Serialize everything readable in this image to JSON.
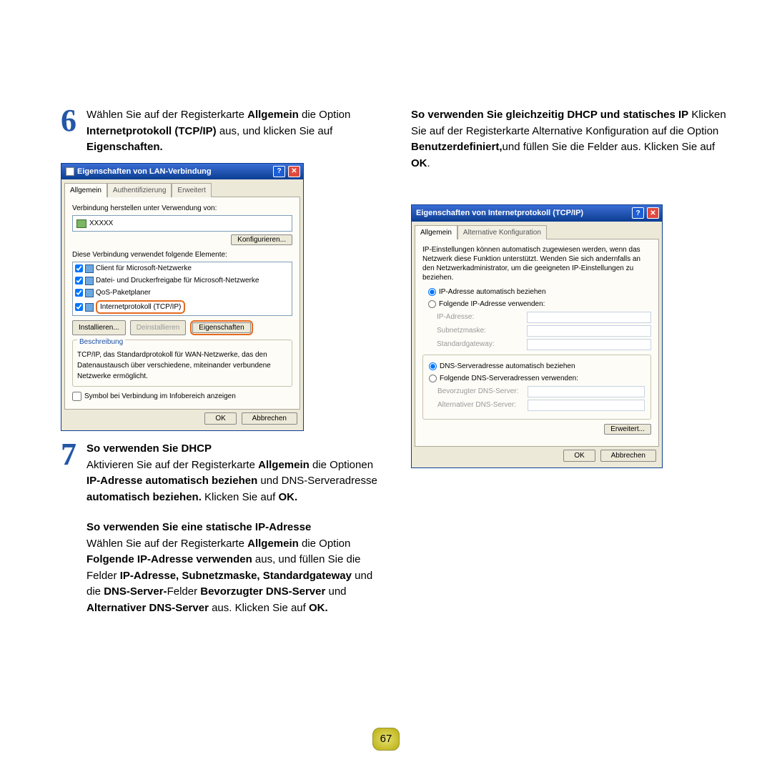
{
  "page_number": "67",
  "left": {
    "step6": {
      "num": "6",
      "p1a": "Wählen Sie auf der Registerkarte ",
      "b1": "Allgemein",
      "p1b": " die Option ",
      "b2": "Internetprotokoll (TCP/IP)",
      "p1c": " aus, und klicken Sie auf ",
      "b3": "Eigenschaften.",
      "p1d": ""
    },
    "dlg1": {
      "title": "Eigenschaften von LAN-Verbindung",
      "tabs": [
        "Allgemein",
        "Authentifizierung",
        "Erweitert"
      ],
      "connect_label": "Verbindung herstellen unter Verwendung von:",
      "adapter": "XXXXX",
      "configure_btn": "Konfigurieren...",
      "elements_label": "Diese Verbindung verwendet folgende Elemente:",
      "elements": [
        "Client für Microsoft-Netzwerke",
        "Datei- und Druckerfreigabe für Microsoft-Netzwerke",
        "QoS-Paketplaner",
        "Internetprotokoll (TCP/IP)"
      ],
      "install_btn": "Installieren...",
      "uninstall_btn": "Deinstallieren",
      "props_btn": "Eigenschaften",
      "desc_legend": "Beschreibung",
      "desc_text": "TCP/IP, das Standardprotokoll für WAN-Netzwerke, das den Datenaustausch über verschiedene, miteinander verbundene Netzwerke ermöglicht.",
      "show_icon": "Symbol bei Verbindung im Infobereich anzeigen",
      "ok": "OK",
      "cancel": "Abbrechen"
    },
    "step7": {
      "num": "7",
      "h1": "So verwenden Sie DHCP",
      "p1a": "Aktivieren Sie auf der Registerkarte ",
      "b1": "Allgemein",
      "p1b": " die Optionen ",
      "b2": "IP-Adresse automatisch beziehen",
      "p1c": " und DNS-Serveradresse ",
      "b3": "automatisch beziehen.",
      "p1d": " Klicken Sie auf ",
      "b4": "OK.",
      "h2": "So verwenden Sie eine statische IP-Adresse",
      "p2a": "Wählen Sie auf der Registerkarte ",
      "b5": "Allgemein",
      "p2b": " die Option ",
      "b6": "Folgende IP-Adresse verwenden",
      "p2c": " aus, und füllen Sie die Felder ",
      "b7": "IP-Adresse, Subnetzmaske, Standardgateway",
      "p2d": " und die ",
      "b8": "DNS-Server-",
      "p2e": "Felder ",
      "b9": "Bevorzugter DNS-Server",
      "p2f": " und ",
      "b10": "Alternativer DNS-Server",
      "p2g": " aus. Klicken Sie auf ",
      "b11": "OK."
    }
  },
  "right": {
    "intro": {
      "h": "So verwenden Sie gleichzeitig DHCP und statisches IP",
      "p1a": " Klicken Sie auf der Registerkarte Alternative Konfiguration auf die Option ",
      "b1": "Benutzerdefiniert,",
      "p1b": "und füllen Sie die Felder aus. Klicken Sie auf ",
      "b2": "OK",
      "p1c": "."
    },
    "dlg2": {
      "title": "Eigenschaften von Internetprotokoll (TCP/IP)",
      "tabs": [
        "Allgemein",
        "Alternative Konfiguration"
      ],
      "info": "IP-Einstellungen können automatisch zugewiesen werden, wenn das Netzwerk diese Funktion unterstützt. Wenden Sie sich andernfalls an den Netzwerkadministrator, um die geeigneten IP-Einstellungen zu beziehen.",
      "r1": "IP-Adresse automatisch beziehen",
      "r2": "Folgende IP-Adresse verwenden:",
      "f_ip": "IP-Adresse:",
      "f_mask": "Subnetzmaske:",
      "f_gw": "Standardgateway:",
      "r3": "DNS-Serveradresse automatisch beziehen",
      "r4": "Folgende DNS-Serveradressen verwenden:",
      "f_dns1": "Bevorzugter DNS-Server:",
      "f_dns2": "Alternativer DNS-Server:",
      "adv_btn": "Erweitert...",
      "ok": "OK",
      "cancel": "Abbrechen"
    }
  }
}
